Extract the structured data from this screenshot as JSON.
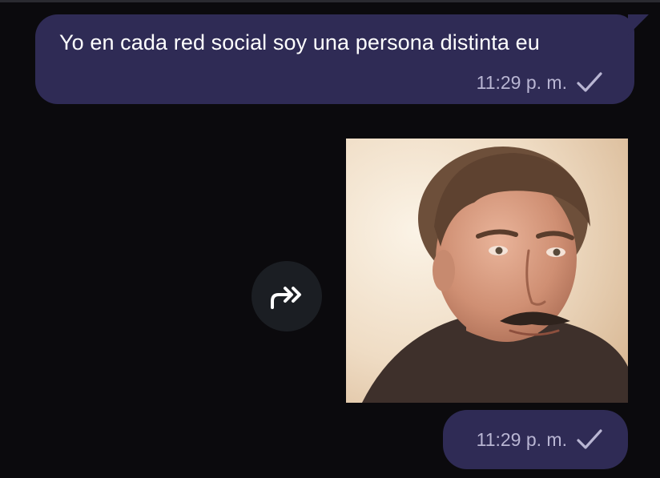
{
  "messages": [
    {
      "text": "Yo en cada red social soy una persona distinta eu",
      "time": "11:29 p. m.",
      "status_icon": "single-check-icon"
    },
    {
      "type": "image",
      "time": "11:29 p. m.",
      "status_icon": "single-check-icon"
    }
  ],
  "actions": {
    "forward_icon": "forward-arrow-icon"
  },
  "colors": {
    "background": "#0b0a0d",
    "bubble": "#2f2b55",
    "meta_text": "#b9b6d3",
    "forward_button": "#1b1e23"
  }
}
